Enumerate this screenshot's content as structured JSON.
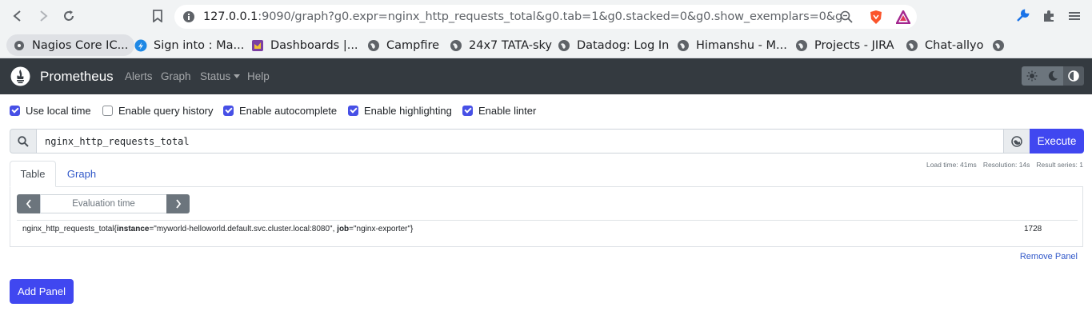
{
  "browser": {
    "url_host": "127.0.0.1",
    "url_rest": ":9090/graph?g0.expr=nginx_http_requests_total&g0.tab=1&g0.stacked=0&g0.show_exemplars=0&g0.range_inpu...",
    "bookmarks": [
      {
        "label": "Nagios Core IC...",
        "icon": "nagios-icon"
      },
      {
        "label": "Sign into : Ma...",
        "icon": "signin-icon"
      },
      {
        "label": "Dashboards |...",
        "icon": "grafana-icon"
      },
      {
        "label": "Campfire",
        "icon": "globe-icon"
      },
      {
        "label": "24x7 TATA-sky",
        "icon": "globe-icon"
      },
      {
        "label": "Datadog: Log In",
        "icon": "globe-icon"
      },
      {
        "label": "Himanshu - M...",
        "icon": "globe-icon"
      },
      {
        "label": "Projects - JIRA",
        "icon": "globe-icon"
      },
      {
        "label": "Chat-allyo",
        "icon": "globe-icon"
      }
    ]
  },
  "navbar": {
    "brand": "Prometheus",
    "links": [
      "Alerts",
      "Graph",
      "Status",
      "Help"
    ]
  },
  "options": [
    {
      "label": "Use local time",
      "checked": true
    },
    {
      "label": "Enable query history",
      "checked": false
    },
    {
      "label": "Enable autocomplete",
      "checked": true
    },
    {
      "label": "Enable highlighting",
      "checked": true
    },
    {
      "label": "Enable linter",
      "checked": true
    }
  ],
  "query": {
    "expression": "nginx_http_requests_total",
    "execute_label": "Execute"
  },
  "stats": {
    "load_time": "Load time: 41ms",
    "resolution": "Resolution: 14s",
    "result_series": "Result series: 1"
  },
  "tabs": [
    "Table",
    "Graph"
  ],
  "evaluation": {
    "placeholder": "Evaluation time"
  },
  "result": {
    "metric": "nginx_http_requests_total{",
    "label1_key": "instance",
    "label1_val": "=\"myworld-helloworld.default.svc.cluster.local:8080\", ",
    "label2_key": "job",
    "label2_val": "=\"nginx-exporter\"}",
    "value": "1728"
  },
  "remove_panel": "Remove Panel",
  "add_panel": "Add Panel",
  "colors": {
    "accent": "#4047f0",
    "navbar": "#343a40",
    "link": "#3158c9"
  }
}
